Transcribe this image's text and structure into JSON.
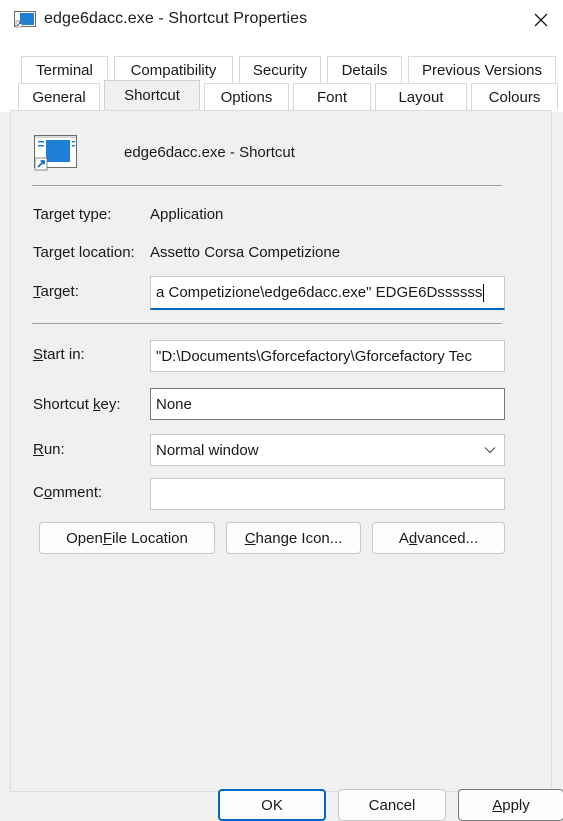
{
  "window": {
    "title": "edge6dacc.exe - Shortcut Properties",
    "close_glyph": "✕"
  },
  "tabs_top": [
    "Terminal",
    "Compatibility",
    "Security",
    "Details",
    "Previous Versions"
  ],
  "tabs_bottom": [
    "General",
    "Shortcut",
    "Options",
    "Font",
    "Layout",
    "Colours"
  ],
  "active_tab": "Shortcut",
  "shortcut_name": "edge6dacc.exe - Shortcut",
  "fields": {
    "target_type_label": "Target type:",
    "target_type_value": "Application",
    "target_location_label": "Target location:",
    "target_location_value": "Assetto Corsa Competizione",
    "target_label_pre": "",
    "target_label_u": "T",
    "target_label_post": "arget:",
    "target_value": "a Competizione\\edge6dacc.exe\" EDGE6Dssssss",
    "start_in_label_u": "S",
    "start_in_label_post": "tart in:",
    "start_in_value": "\"D:\\Documents\\Gforcefactory\\Gforcefactory Tec",
    "shortcut_key_label_pre": "Shortcut ",
    "shortcut_key_label_u": "k",
    "shortcut_key_label_post": "ey:",
    "shortcut_key_value": "None",
    "run_label_u": "R",
    "run_label_post": "un:",
    "run_value": "Normal window",
    "comment_label_pre": "C",
    "comment_label_u": "o",
    "comment_label_post": "mment:",
    "comment_value": ""
  },
  "buttons": {
    "open_file_pre": "Open ",
    "open_file_u": "F",
    "open_file_post": "ile Location",
    "change_icon_u": "C",
    "change_icon_post": "hange Icon...",
    "advanced_pre": "A",
    "advanced_u": "d",
    "advanced_post": "vanced...",
    "ok": "OK",
    "cancel": "Cancel",
    "apply_u": "A",
    "apply_post": "pply"
  },
  "colors": {
    "accent": "#0067c0",
    "icon_blue": "#1e7fd6"
  }
}
